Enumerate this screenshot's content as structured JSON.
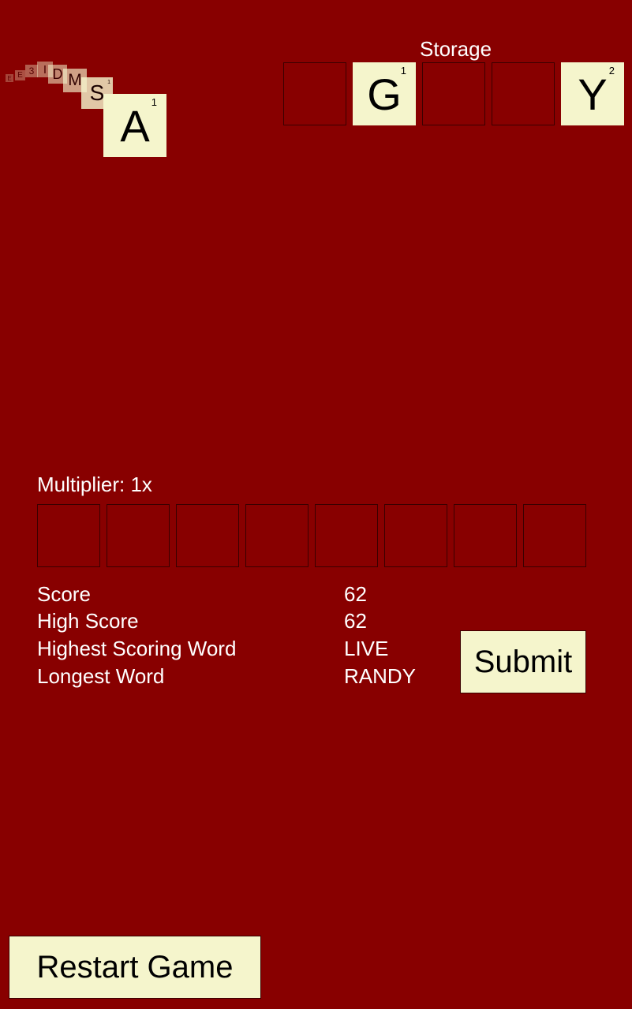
{
  "falling_tiles": [
    {
      "letter": "E",
      "points": ""
    },
    {
      "letter": "E",
      "points": ""
    },
    {
      "letter": "3",
      "points": ""
    },
    {
      "letter": "I",
      "points": ""
    },
    {
      "letter": "D",
      "points": ""
    },
    {
      "letter": "M",
      "points": ""
    },
    {
      "letter": "S",
      "points": "1"
    },
    {
      "letter": "A",
      "points": "1"
    }
  ],
  "storage": {
    "label": "Storage",
    "slots": [
      {
        "letter": "",
        "points": ""
      },
      {
        "letter": "G",
        "points": "1"
      },
      {
        "letter": "",
        "points": ""
      },
      {
        "letter": "",
        "points": ""
      },
      {
        "letter": "Y",
        "points": "2"
      }
    ]
  },
  "word": {
    "multiplier_label": "Multiplier: 1x",
    "slot_count": 8
  },
  "stats": [
    {
      "label": "Score",
      "value": "62"
    },
    {
      "label": "High Score",
      "value": "62"
    },
    {
      "label": "Highest Scoring Word",
      "value": "LIVE"
    },
    {
      "label": "Longest Word",
      "value": "RANDY"
    }
  ],
  "buttons": {
    "submit": "Submit",
    "restart": "Restart Game"
  },
  "colors": {
    "background": "#880000",
    "tile": "#f5f5cc",
    "slot_border": "#3a0000",
    "text": "#ffffff"
  }
}
